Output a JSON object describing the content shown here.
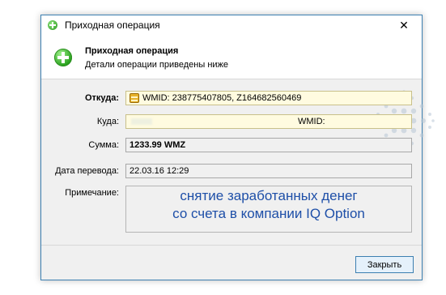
{
  "window": {
    "title": "Приходная операция",
    "close_glyph": "✕"
  },
  "header": {
    "title": "Приходная операция",
    "subtitle": "Детали операции приведены ниже"
  },
  "fields": {
    "from_label": "Откуда:",
    "from_value": "WMID: 238775407805, Z164682560469",
    "to_label": "Куда:",
    "to_value": "WMID:",
    "amount_label": "Сумма:",
    "amount_value": "1233.99 WMZ",
    "date_label": "Дата перевода:",
    "date_value": "22.03.16 12:29",
    "note_label": "Примечание:",
    "note_line1": "снятие заработанных денег",
    "note_line2": "со счета в компании IQ Option"
  },
  "footer": {
    "close_button": "Закрыть"
  },
  "colors": {
    "accent": "#3c7fb1",
    "note_text": "#1e4fa8",
    "highlight_field": "#fffbe0"
  }
}
